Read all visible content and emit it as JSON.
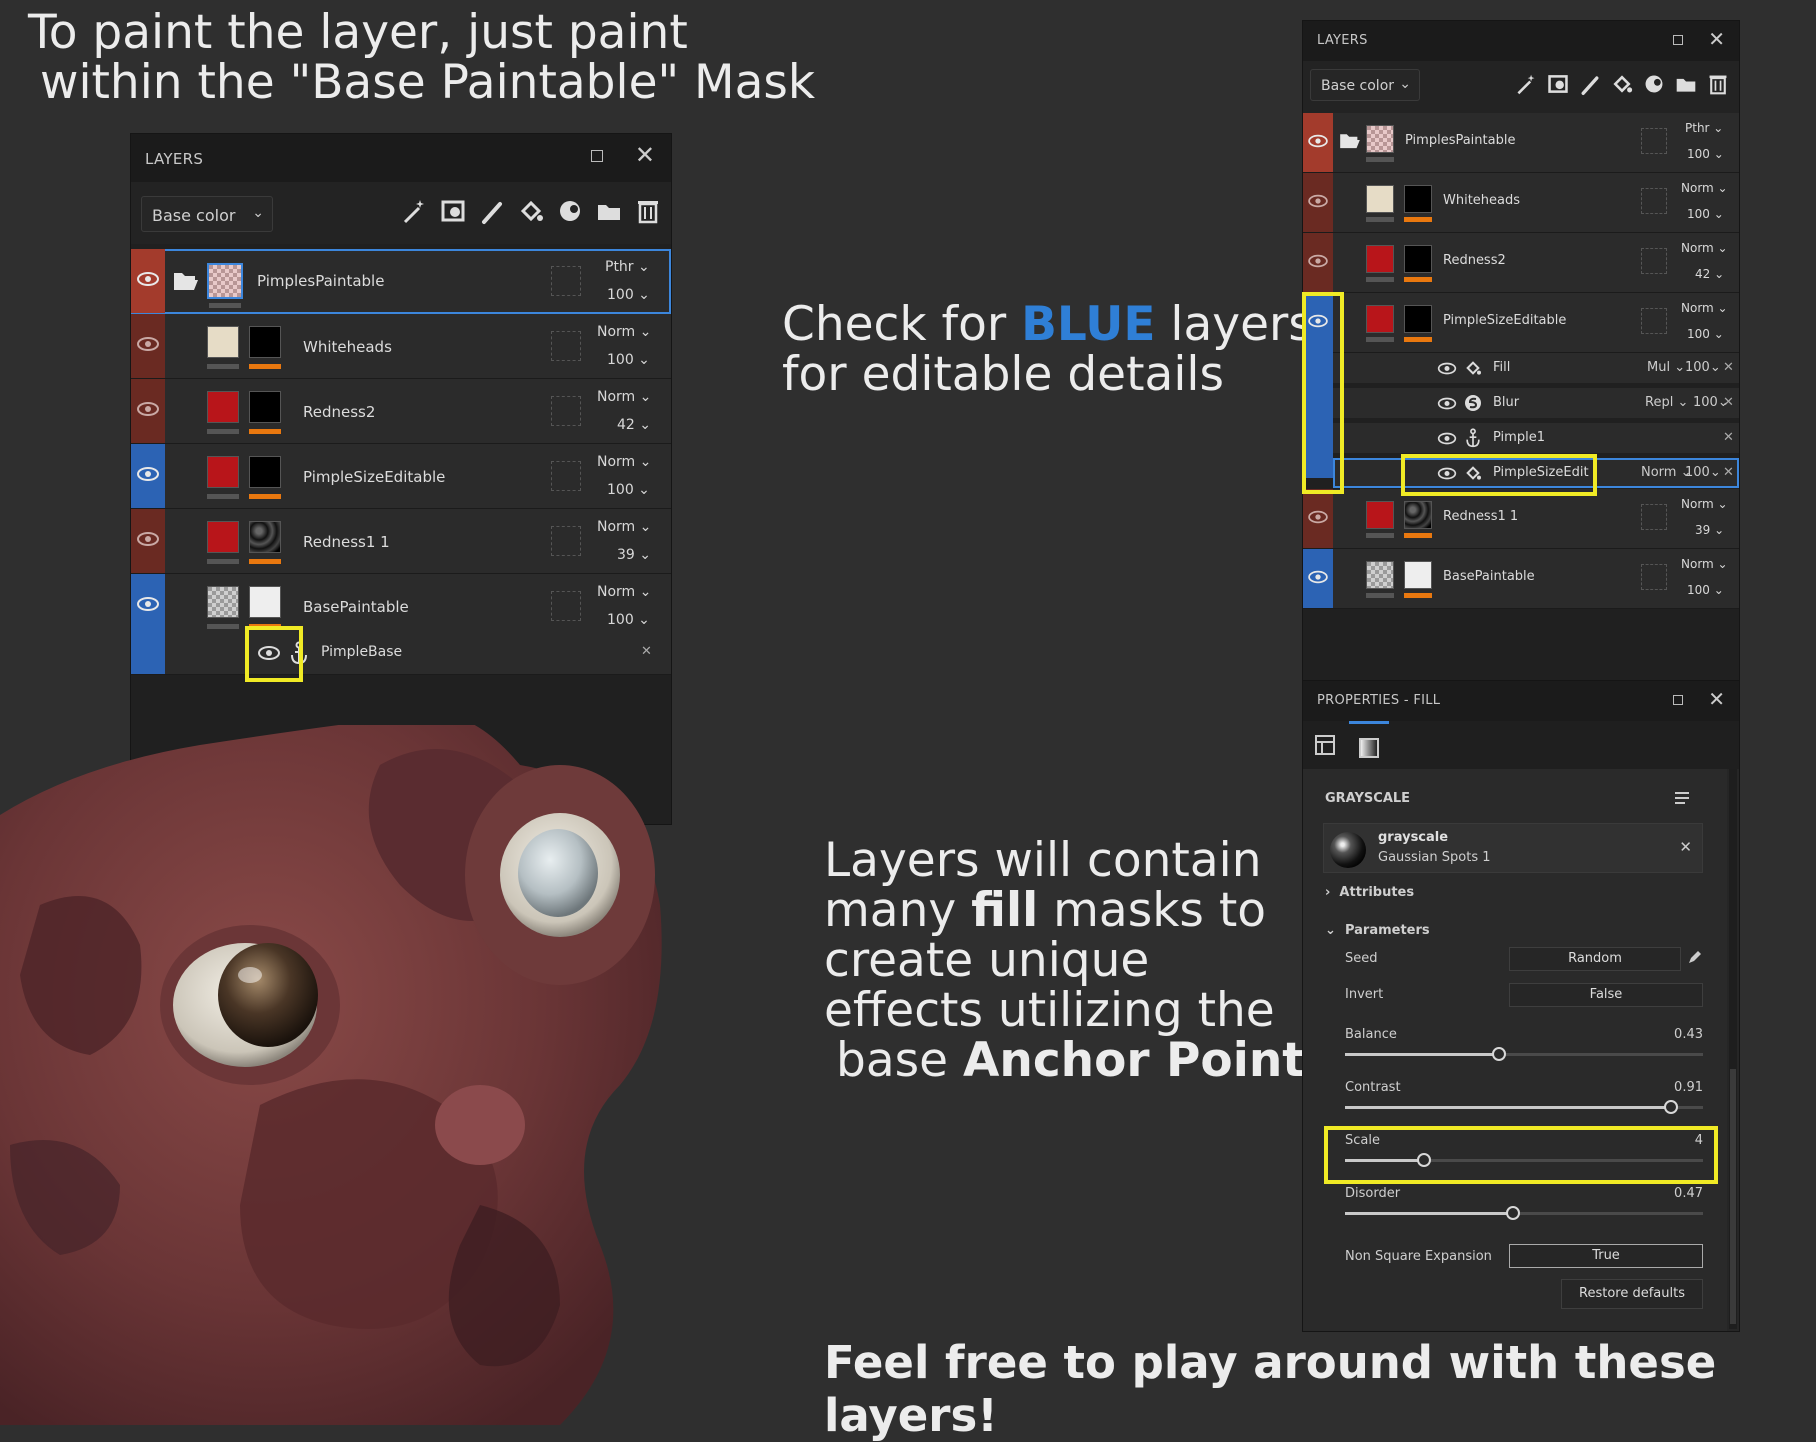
{
  "headlines": {
    "paint_line1": "To paint the layer, just paint",
    "paint_line2": "within the \"Base Paintable\" Mask",
    "check_pre": "Check for ",
    "check_blue": "BLUE",
    "check_post": " layers",
    "check_line2": "for editable details",
    "fill_line1": "Layers will contain",
    "fill_line2_pre": "many ",
    "fill_line2_bold": "fill",
    "fill_line2_post": " masks to",
    "fill_line3": "create unique",
    "fill_line4": "effects utilizing the",
    "fill_line5_pre": "base ",
    "fill_line5_bold": "Anchor Point.",
    "footer": "Feel free to play around with these layers!"
  },
  "left_panel": {
    "title": "LAYERS",
    "channel": "Base color",
    "layers": [
      {
        "name": "PimplesPaintable",
        "blend": "Pthr",
        "opacity": "100"
      },
      {
        "name": "Whiteheads",
        "blend": "Norm",
        "opacity": "100"
      },
      {
        "name": "Redness2",
        "blend": "Norm",
        "opacity": "42"
      },
      {
        "name": "PimpleSizeEditable",
        "blend": "Norm",
        "opacity": "100"
      },
      {
        "name": "Redness1 1",
        "blend": "Norm",
        "opacity": "39"
      },
      {
        "name": "BasePaintable",
        "blend": "Norm",
        "opacity": "100"
      }
    ],
    "sub": {
      "name": "PimpleBase"
    }
  },
  "right_panel": {
    "title": "LAYERS",
    "channel": "Base color",
    "layers": [
      {
        "name": "PimplesPaintable",
        "blend": "Pthr",
        "opacity": "100"
      },
      {
        "name": "Whiteheads",
        "blend": "Norm",
        "opacity": "100"
      },
      {
        "name": "Redness2",
        "blend": "Norm",
        "opacity": "42"
      },
      {
        "name": "PimpleSizeEditable",
        "blend": "Norm",
        "opacity": "100"
      },
      {
        "name": "Redness1 1",
        "blend": "Norm",
        "opacity": "39"
      },
      {
        "name": "BasePaintable",
        "blend": "Norm",
        "opacity": "100"
      }
    ],
    "effects": [
      {
        "name": "Fill",
        "blend": "Mul",
        "opacity": "100"
      },
      {
        "name": "Blur",
        "blend": "Repl",
        "opacity": "100"
      },
      {
        "name": "Pimple1",
        "blend": "",
        "opacity": ""
      },
      {
        "name": "PimpleSizeEdit",
        "blend": "Norm",
        "opacity": "100"
      }
    ]
  },
  "properties": {
    "title": "PROPERTIES - FILL",
    "section": "GRAYSCALE",
    "resource_name": "grayscale",
    "resource_sub": "Gaussian Spots 1",
    "attributes": "Attributes",
    "parameters": "Parameters",
    "seed_label": "Seed",
    "seed_value": "Random",
    "invert_label": "Invert",
    "invert_value": "False",
    "sliders": [
      {
        "label": "Balance",
        "value": "0.43",
        "fraction": 0.43
      },
      {
        "label": "Contrast",
        "value": "0.91",
        "fraction": 0.91
      },
      {
        "label": "Scale",
        "value": "4",
        "fraction": 0.22
      },
      {
        "label": "Disorder",
        "value": "0.47",
        "fraction": 0.47
      }
    ],
    "nse_label": "Non Square Expansion",
    "nse_value": "True",
    "restore": "Restore defaults"
  },
  "colors": {
    "accent_blue": "#2f7fd6",
    "highlight_yellow": "#f0ea25",
    "orange_bar": "#e9780f"
  }
}
